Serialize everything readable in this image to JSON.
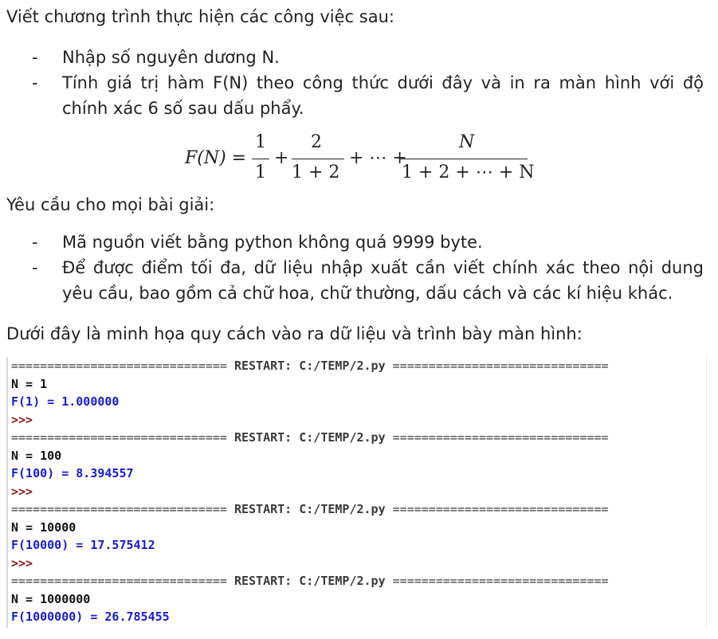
{
  "intro": "Viết chương trình thực hiện các công việc sau:",
  "tasks": [
    "Nhập số nguyên dương N.",
    "Tính giá trị hàm F(N) theo công thức dưới đây và in ra màn hình với độ chính xác 6 số sau dấu phẩy."
  ],
  "bullet_mark": "-",
  "formula": {
    "lhs": "F(N) =",
    "t1_num": "1",
    "t1_den": "1",
    "plus": "+",
    "t2_num": "2",
    "t2_den": "1 + 2",
    "dots": "+ ⋯ +",
    "tn_num": "N",
    "tn_den": "1 + 2 + ⋯ + N"
  },
  "requirements_title": "Yêu cầu cho mọi bài giải:",
  "requirements": [
    "Mã nguồn viết bằng python không quá 9999 byte.",
    "Để được điểm tối đa, dữ liệu nhập xuất cần viết chính xác theo nội dung yêu cầu, bao gồm cả chữ hoa, chữ thường, dấu cách và các kí hiệu khác."
  ],
  "example_title": "Dưới đây là minh họa quy cách vào ra dữ liệu và trình bày màn hình:",
  "console": {
    "restart_text": "RESTART: C:/TEMP/2.py",
    "prompt": ">>>",
    "runs": [
      {
        "input": "N = 1",
        "output": "F(1) = 1.000000"
      },
      {
        "input": "N = 100",
        "output": "F(100) = 8.394557"
      },
      {
        "input": "N = 10000",
        "output": "F(10000) = 17.575412"
      },
      {
        "input": "N = 1000000",
        "output": "F(1000000) = 26.785455"
      }
    ]
  }
}
